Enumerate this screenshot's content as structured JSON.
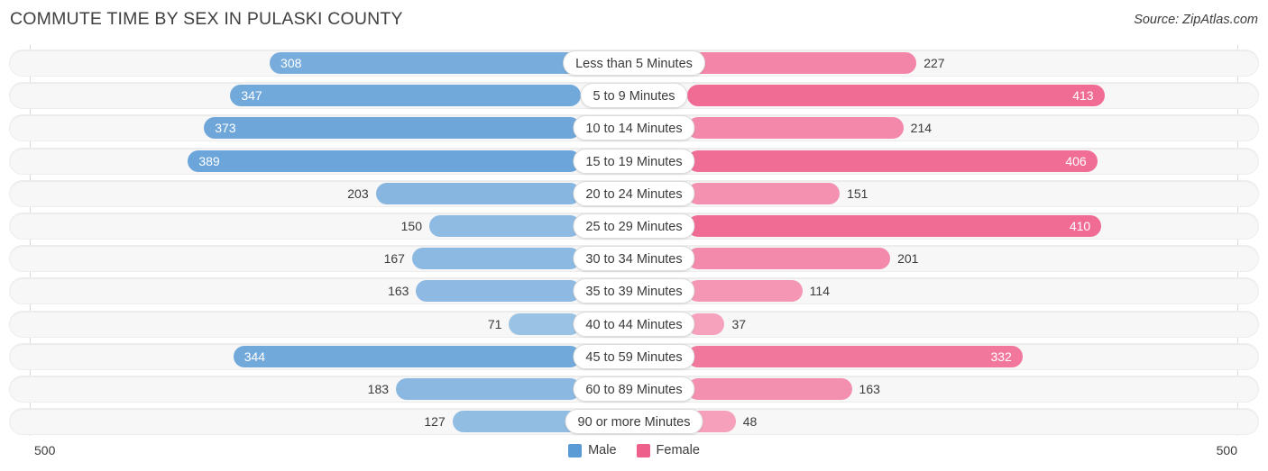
{
  "title": "COMMUTE TIME BY SEX IN PULASKI COUNTY",
  "source": "Source: ZipAtlas.com",
  "axis": {
    "left_end_label": "500",
    "right_end_label": "500",
    "max": 500
  },
  "legend": {
    "items": [
      {
        "label": "Male",
        "color": "#5b9bd5",
        "icon": "square-swatch"
      },
      {
        "label": "Female",
        "color": "#ef5f8c",
        "icon": "square-swatch"
      }
    ]
  },
  "chart_data": {
    "type": "bar",
    "orientation": "diverging-horizontal",
    "title": "COMMUTE TIME BY SEX IN PULASKI COUNTY",
    "xlabel": "",
    "ylabel": "",
    "xlim": [
      500,
      500
    ],
    "grid": false,
    "legend_position": "bottom-center",
    "categories": [
      "Less than 5 Minutes",
      "5 to 9 Minutes",
      "10 to 14 Minutes",
      "15 to 19 Minutes",
      "20 to 24 Minutes",
      "25 to 29 Minutes",
      "30 to 34 Minutes",
      "35 to 39 Minutes",
      "40 to 44 Minutes",
      "45 to 59 Minutes",
      "60 to 89 Minutes",
      "90 or more Minutes"
    ],
    "series": [
      {
        "name": "Male",
        "color": "#5b9bd5",
        "side": "left",
        "values": [
          308,
          347,
          373,
          389,
          203,
          150,
          167,
          163,
          71,
          344,
          183,
          127
        ]
      },
      {
        "name": "Female",
        "color": "#ef5f8c",
        "side": "right",
        "values": [
          227,
          413,
          214,
          406,
          151,
          410,
          201,
          114,
          37,
          332,
          163,
          48
        ]
      }
    ]
  }
}
